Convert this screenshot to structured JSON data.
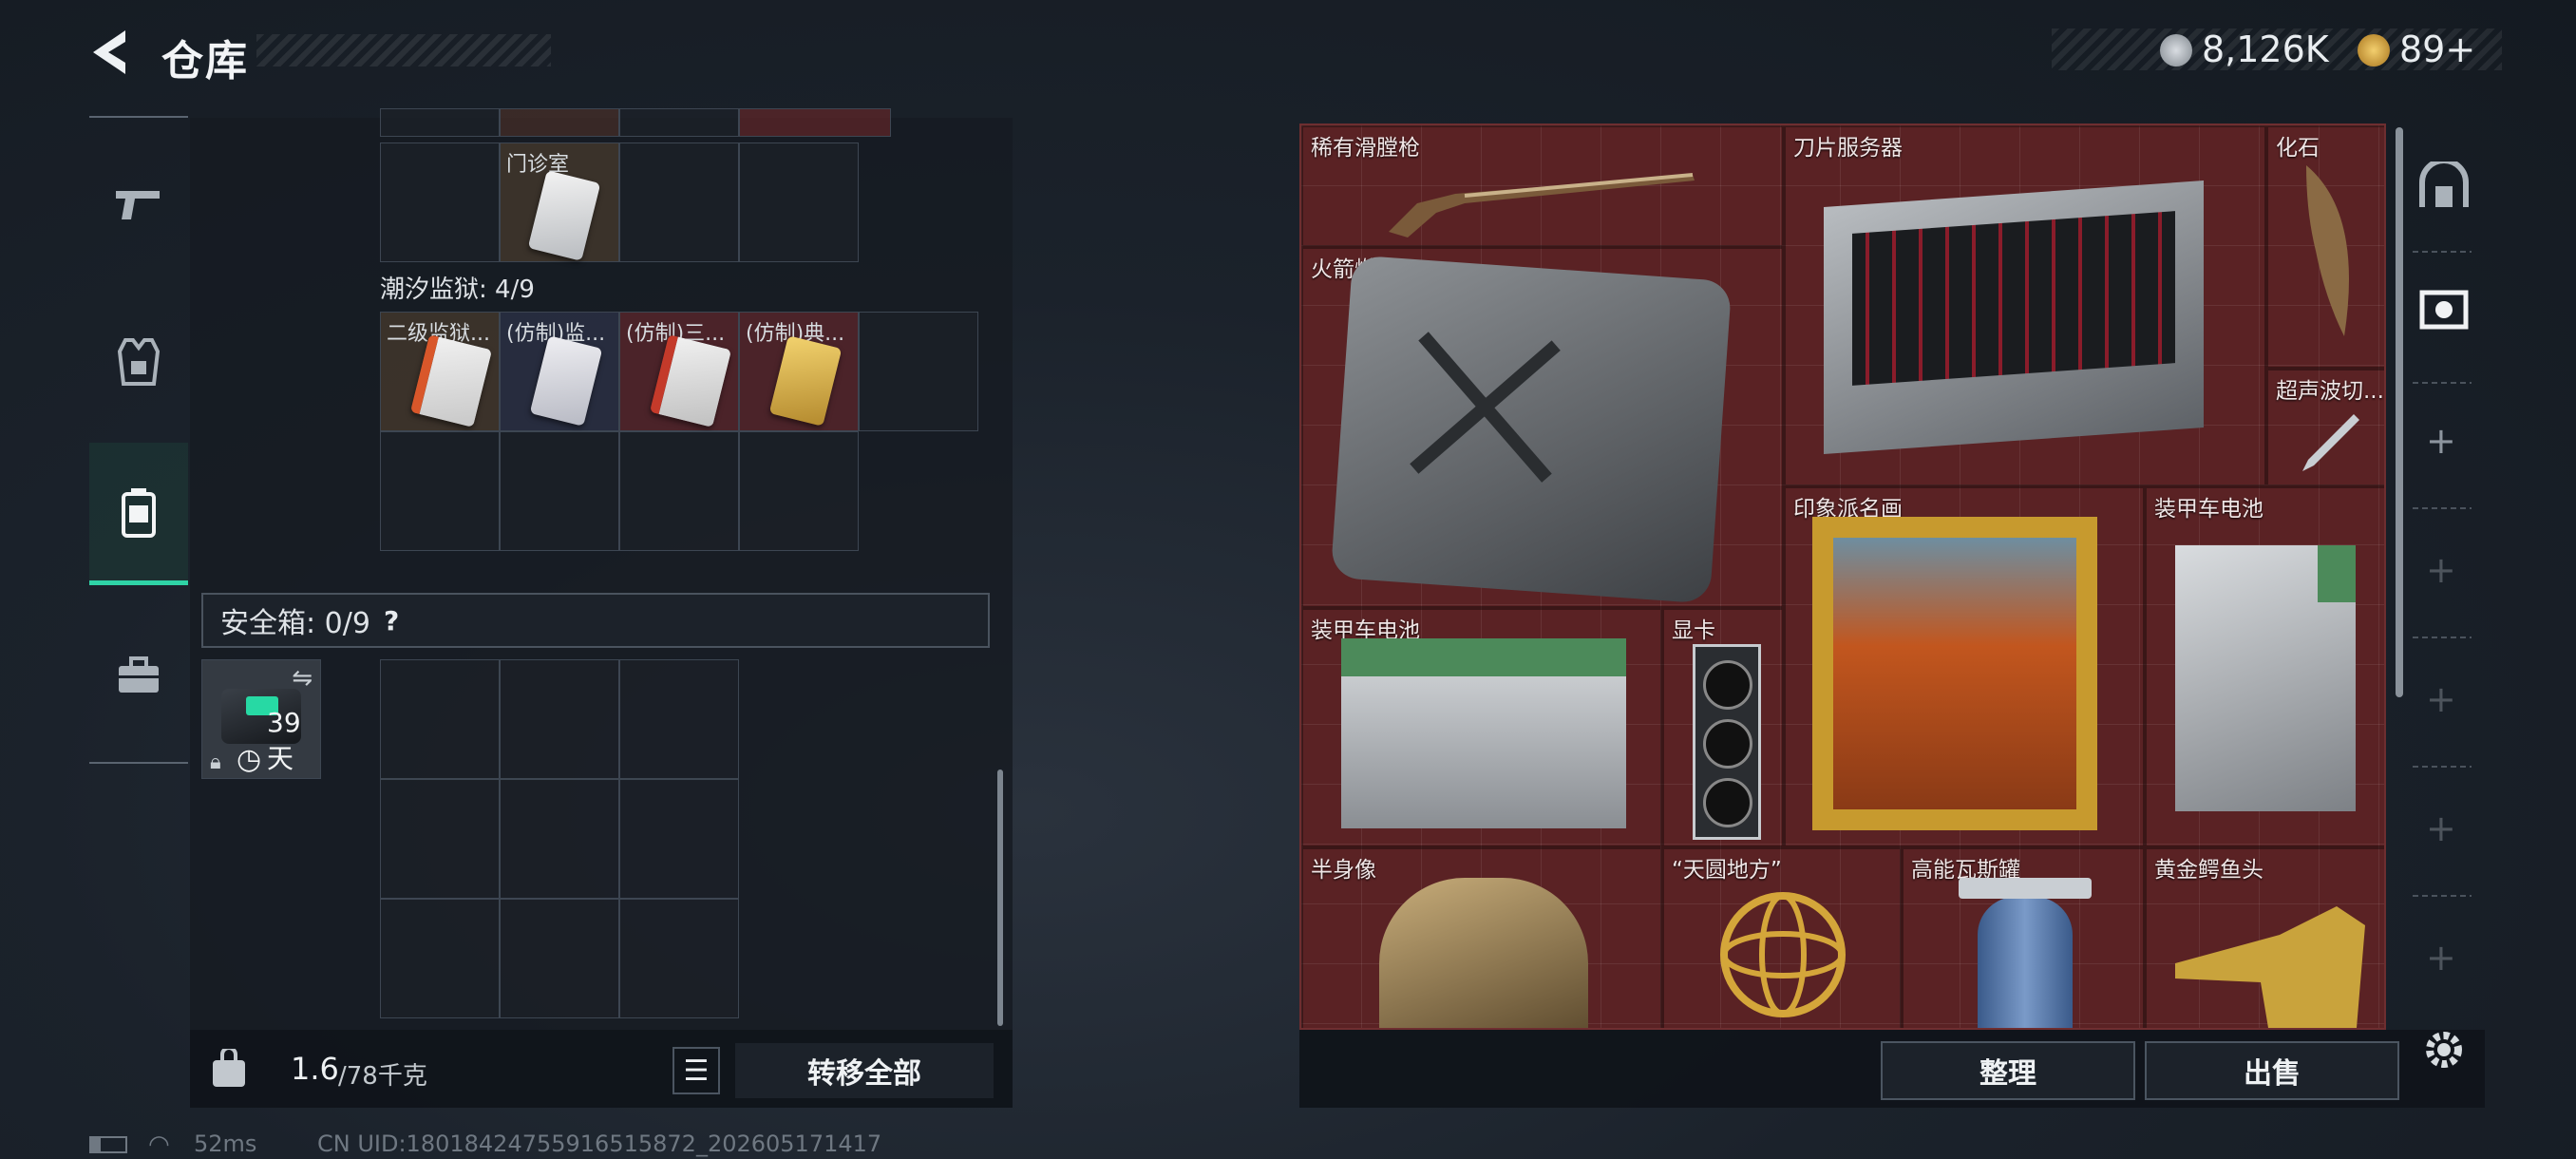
{
  "header": {
    "title": "仓库"
  },
  "currency": [
    {
      "icon": "silver-coin-icon",
      "value": "8,126K",
      "color": "#b8bcc2"
    },
    {
      "icon": "gold-triangle-coin-icon",
      "value": "89+",
      "color": "#d6a640"
    }
  ],
  "backpack": {
    "clinic_label": "门诊室",
    "prison_section": "潮汐监狱: 4/9",
    "prison_items": [
      "二级监狱...",
      "(仿制)监...",
      "(仿制)三...",
      "(仿制)典..."
    ],
    "safebox_label": "安全箱: 0/9",
    "safebox_help": "?",
    "safebox_timer": "39天",
    "weight_current": "1.6",
    "weight_max": "/78千克",
    "transfer_all": "转移全部"
  },
  "stash": {
    "items": [
      {
        "name": "稀有滑膛枪"
      },
      {
        "name": "刀片服务器"
      },
      {
        "name": "化石"
      },
      {
        "name": "火箭燃料"
      },
      {
        "name": "超声波切..."
      },
      {
        "name": "印象派名画"
      },
      {
        "name": "装甲车电池"
      },
      {
        "name": "装甲车电池"
      },
      {
        "name": "显卡"
      },
      {
        "name": "半身像"
      },
      {
        "name": "“天圆地方”"
      },
      {
        "name": "高能瓦斯罐"
      },
      {
        "name": "黄金鳄鱼头"
      }
    ],
    "sort_button": "整理",
    "sell_button": "出售",
    "rail_plus": "+"
  },
  "status": {
    "ping": "52ms",
    "uid": "CN UID:18018424755916515872_202605171417"
  }
}
